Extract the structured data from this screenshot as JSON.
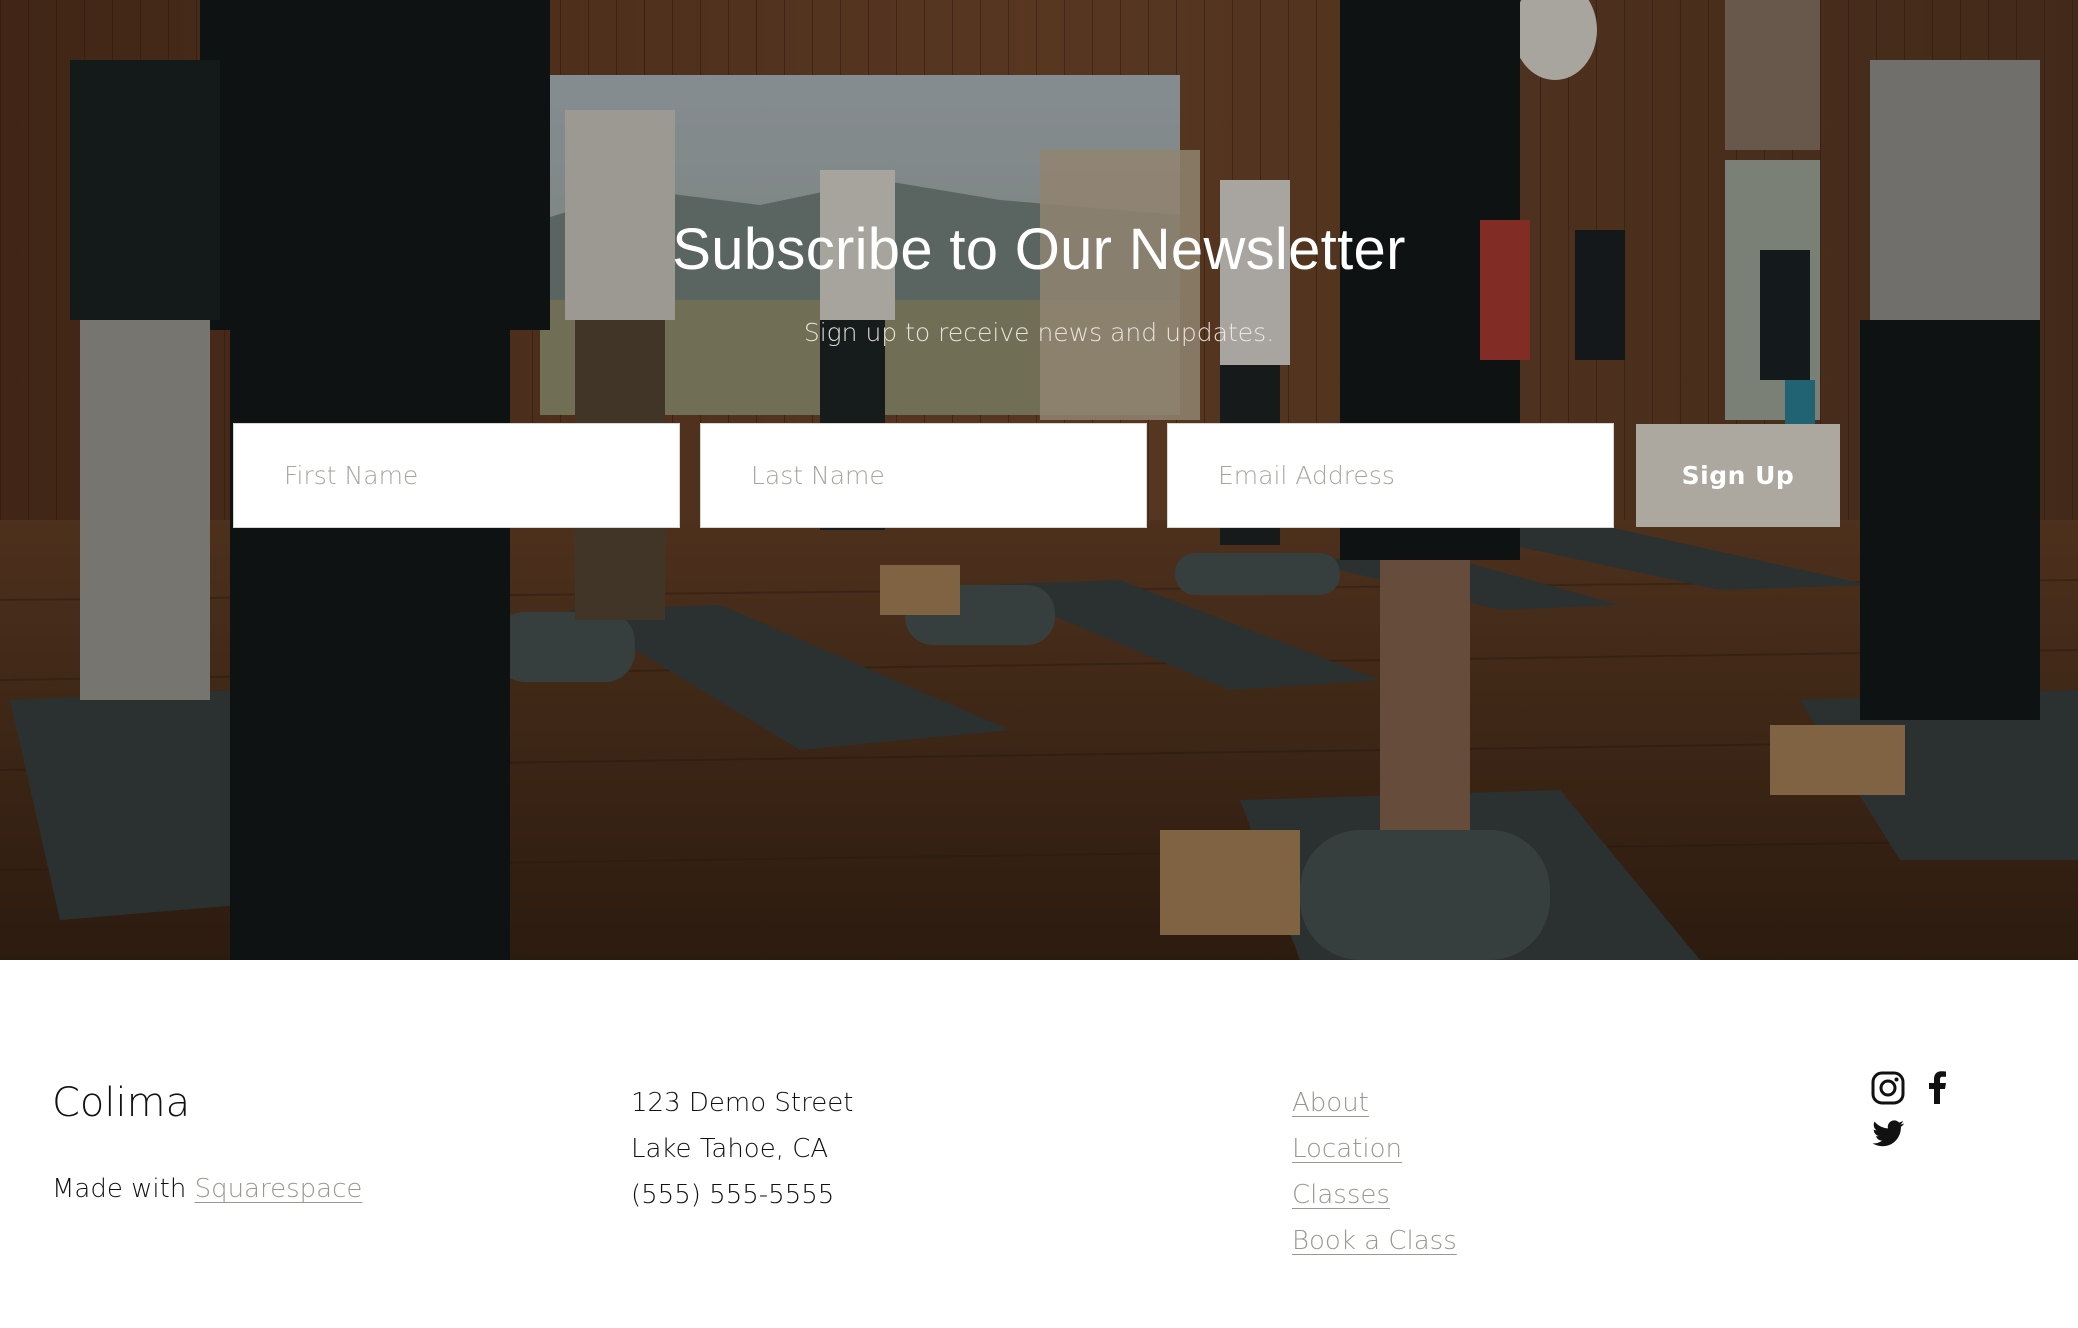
{
  "newsletter": {
    "title": "Subscribe to Our Newsletter",
    "subtitle": "Sign up to receive news and updates.",
    "first_name_placeholder": "First Name",
    "last_name_placeholder": "Last Name",
    "email_placeholder": "Email Address",
    "submit_label": "Sign Up",
    "background_image": "yoga-class-photo"
  },
  "footer": {
    "brand": "Colima",
    "made_with_prefix": "Made with",
    "made_with_link": "Squarespace",
    "address": {
      "street": "123 Demo Street",
      "city": "Lake Tahoe, CA",
      "phone": "(555) 555-5555"
    },
    "nav": [
      {
        "label": "About"
      },
      {
        "label": "Location"
      },
      {
        "label": "Classes"
      },
      {
        "label": "Book a Class"
      }
    ],
    "social": [
      "instagram-icon",
      "facebook-icon",
      "twitter-icon"
    ]
  },
  "colors": {
    "button": "#aca79f",
    "link": "#9a9690",
    "text": "#111111"
  }
}
